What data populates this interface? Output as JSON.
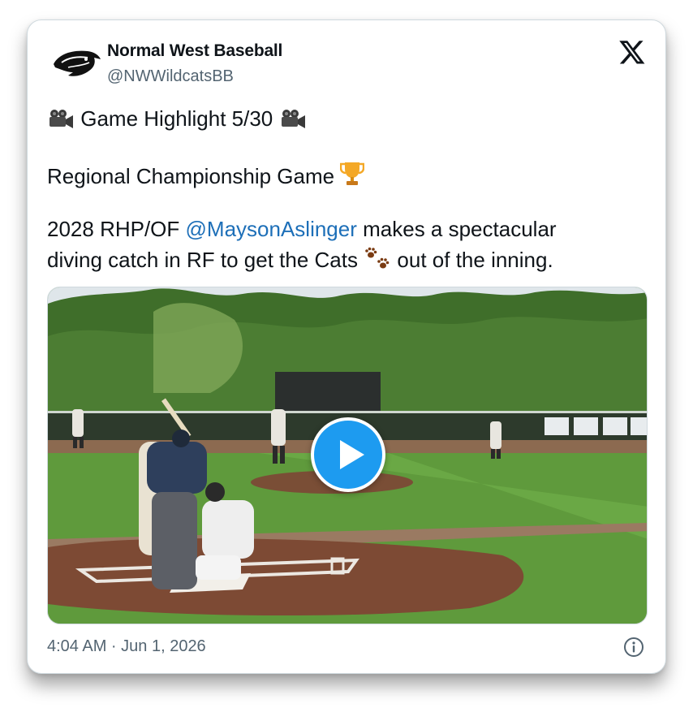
{
  "account": {
    "name": "Normal West Baseball",
    "handle": "@NWWildcatsBB",
    "avatar_icon": "wildcat-logo-icon"
  },
  "platform_icon": "x-logo-icon",
  "tweet": {
    "line1": {
      "icon": "movie-camera-emoji",
      "text": "Game Highlight  5/30"
    },
    "line2": {
      "text": "Regional Championship Game",
      "icon": "trophy-emoji"
    },
    "line3": {
      "prefix": "2028 RHP/OF ",
      "mention": "@MaysonAslinger",
      "suffix": "  makes a spectacular"
    },
    "line4": {
      "prefix": "diving catch in RF to get the Cats ",
      "icon": "paw-prints-emoji",
      "suffix": " out of the inning."
    }
  },
  "media": {
    "type": "video",
    "play_icon": "play-icon"
  },
  "footer": {
    "timestamp": "4:04 AM · Jun 1, 2026",
    "info_icon": "info-icon"
  },
  "colors": {
    "mention": "#1d6fb8",
    "play_button": "#1d9bf0",
    "text": "#0f1419",
    "muted": "#536471"
  }
}
